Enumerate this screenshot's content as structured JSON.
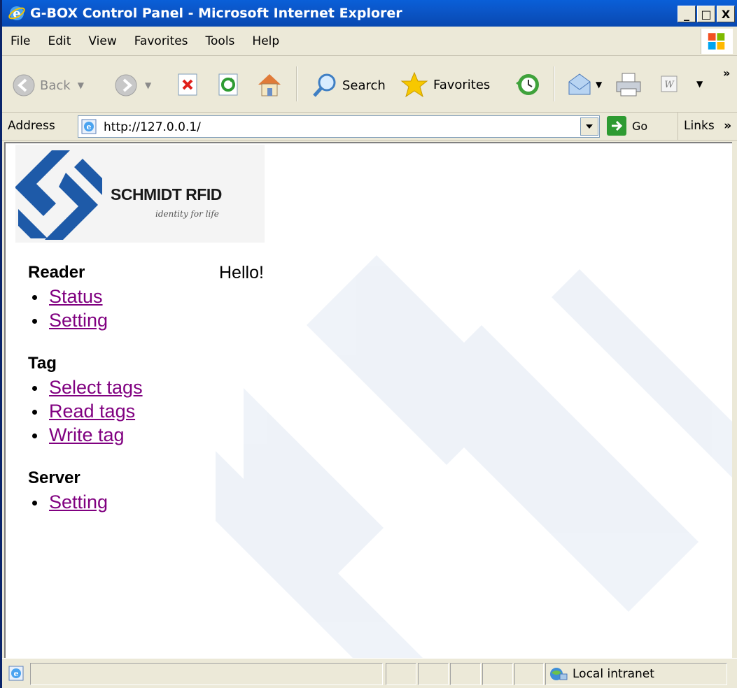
{
  "window": {
    "title": "G-BOX Control Panel - Microsoft Internet Explorer",
    "buttons": [
      "_",
      "□",
      "X"
    ]
  },
  "menu": {
    "items": [
      "File",
      "Edit",
      "View",
      "Favorites",
      "Tools",
      "Help"
    ]
  },
  "toolbar": {
    "back_label": "Back",
    "search_label": "Search",
    "favorites_label": "Favorites",
    "more": "»"
  },
  "address": {
    "label": "Address",
    "url": "http://127.0.0.1/",
    "go_label": "Go",
    "links_label": "Links",
    "links_more": "»"
  },
  "page": {
    "logo_text": "SCHMIDT RFID",
    "logo_tagline": "identity for life",
    "greeting": "Hello!",
    "sections": [
      {
        "heading": "Reader",
        "links": [
          "Status",
          "Setting"
        ]
      },
      {
        "heading": "Tag",
        "links": [
          "Select tags",
          "Read tags",
          "Write tag"
        ]
      },
      {
        "heading": "Server",
        "links": [
          "Setting"
        ]
      }
    ]
  },
  "status": {
    "zone_label": "Local intranet"
  },
  "colors": {
    "titlebar": "#0a5fd8",
    "chrome": "#ece9d8",
    "visited_link": "#800080",
    "logo_blue": "#1e5aa8"
  }
}
